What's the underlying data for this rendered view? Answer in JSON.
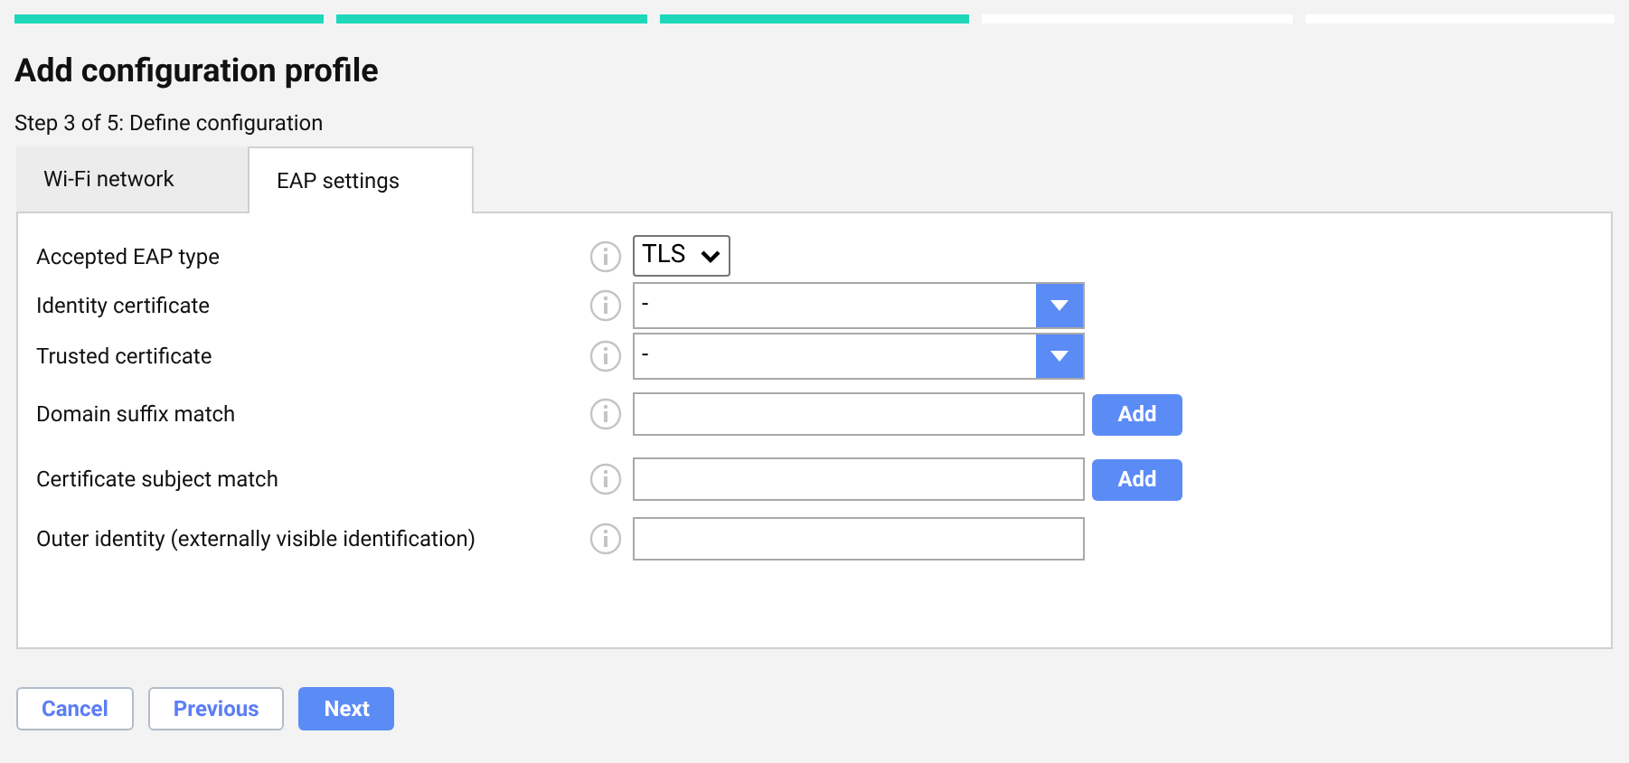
{
  "progress": [
    {
      "done": true
    },
    {
      "done": true
    },
    {
      "done": true
    },
    {
      "done": false
    },
    {
      "done": false
    }
  ],
  "title": "Add configuration profile",
  "step": "Step 3 of 5: Define configuration",
  "tabs": [
    {
      "label": "Wi-Fi network",
      "selected": false
    },
    {
      "label": "EAP settings",
      "selected": true
    }
  ],
  "fields": [
    {
      "kind": "select",
      "label": "Accepted EAP type",
      "value": "TLS"
    },
    {
      "kind": "dropdown",
      "label": "Identity certificate",
      "value": "-"
    },
    {
      "kind": "dropdown",
      "label": "Trusted certificate",
      "value": "-"
    },
    {
      "kind": "text_add",
      "label": "Domain suffix match",
      "button": "Add"
    },
    {
      "kind": "text_add",
      "label": "Certificate subject match",
      "button": "Add"
    },
    {
      "kind": "text",
      "label": "Outer identity (externally visible identification)"
    }
  ],
  "buttons": [
    {
      "label": "Cancel",
      "kind": "secondary"
    },
    {
      "label": "Previous",
      "kind": "secondary"
    },
    {
      "label": "Next",
      "kind": "primary"
    }
  ]
}
